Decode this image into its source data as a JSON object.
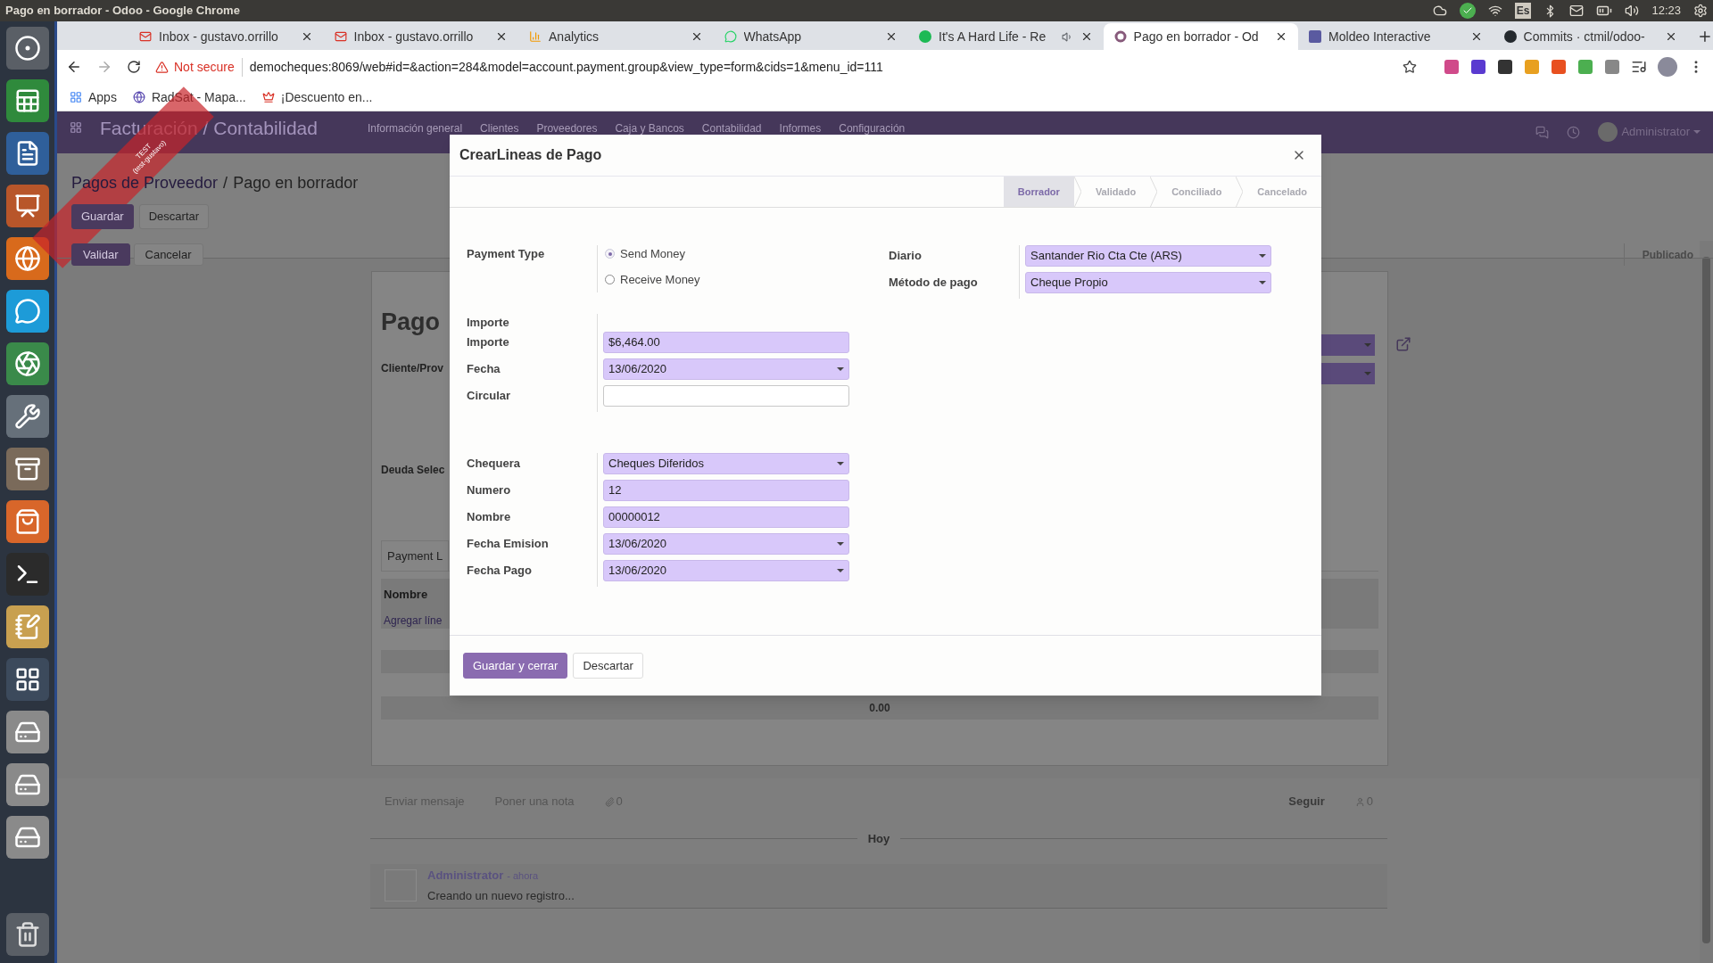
{
  "desktop_bar": {
    "title": "Pago en borrador - Odoo - Google Chrome",
    "keyboard": "Es",
    "clock": "12:23"
  },
  "browser": {
    "tabs": [
      {
        "label": "Inbox - gustavo.orrillo",
        "kind": "mail",
        "selected": false
      },
      {
        "label": "Inbox - gustavo.orrillo",
        "kind": "mail",
        "selected": false
      },
      {
        "label": "Analytics",
        "kind": "chart",
        "selected": false
      },
      {
        "label": "WhatsApp",
        "kind": "chat",
        "selected": false
      },
      {
        "label": "It's A Hard Life - Re",
        "kind": "music",
        "selected": false
      },
      {
        "label": "Pago en borrador - Od",
        "kind": "ring",
        "selected": true
      },
      {
        "label": "Moldeo Interactive",
        "kind": "square",
        "selected": false
      },
      {
        "label": "Commits · ctmil/odoo-",
        "kind": "octo",
        "selected": false
      }
    ],
    "warning": "Not secure",
    "url": "democheques:8069/web#id=&action=284&model=account.payment.group&view_type=form&cids=1&menu_id=111",
    "bookmarks": [
      {
        "label": "Apps",
        "kind": "grid"
      },
      {
        "label": "RadSat - Mapa...",
        "kind": "globe"
      },
      {
        "label": "¡Descuento en...",
        "kind": "crown"
      }
    ]
  },
  "app": {
    "title": "Facturación / Contabilidad",
    "menu": [
      "Información general",
      "Clientes",
      "Proveedores",
      "Caja y Bancos",
      "Contabilidad",
      "Informes",
      "Configuración"
    ],
    "user": "Administrator",
    "ribbon": [
      "TEST",
      "(test-gustavo)"
    ]
  },
  "breadcrumb": {
    "parent": "Pagos de Proveedor",
    "separator": "/",
    "current": "Pago en borrador"
  },
  "edit_buttons": [
    {
      "label": "Guardar",
      "primary": true
    },
    {
      "label": "Descartar",
      "primary": false
    }
  ],
  "status_buttons": [
    {
      "label": "Validar",
      "primary": true
    },
    {
      "label": "Cancelar",
      "primary": false
    }
  ],
  "published": "Publicado",
  "sheet": {
    "title": "Pago",
    "fields": [
      "Cliente/Prov",
      "Deuda Selec"
    ],
    "tab": "Payment L",
    "column": "Nombre",
    "add_line": "Agregar líne",
    "total": "0.00"
  },
  "chatter": {
    "send": "Enviar mensaje",
    "note": "Poner una nota",
    "attachments": "0",
    "follow": "Seguir",
    "followers": "0",
    "date": "Hoy",
    "message": {
      "author": "Administrator",
      "time": "- ahora",
      "body": "Creando un nuevo registro..."
    }
  },
  "dialog": {
    "title": "CrearLineas de Pago",
    "stages": [
      {
        "label": "Borrador",
        "selected": true
      },
      {
        "label": "Validado",
        "selected": false
      },
      {
        "label": "Conciliado",
        "selected": false
      },
      {
        "label": "Cancelado",
        "selected": false
      }
    ],
    "payment_type": {
      "label": "Payment Type",
      "options": [
        {
          "label": "Send Money",
          "selected": true
        },
        {
          "label": "Receive Money",
          "selected": false
        }
      ]
    },
    "right_fields": [
      {
        "label": "Diario",
        "value": "Santander Rio Cta Cte (ARS)",
        "kind": "select",
        "required": true
      },
      {
        "label": "Método de pago",
        "value": "Cheque Propio",
        "kind": "select",
        "required": true
      }
    ],
    "amount_group": {
      "heading": "Importe",
      "fields": [
        {
          "label": "Importe",
          "value": "$6,464.00",
          "kind": "text",
          "required": true
        },
        {
          "label": "Fecha",
          "value": "13/06/2020",
          "kind": "select",
          "required": true
        },
        {
          "label": "Circular",
          "kind": "text",
          "required": false
        }
      ]
    },
    "check_fields": [
      {
        "label": "Chequera",
        "value": "Cheques Diferidos",
        "kind": "select",
        "required": true
      },
      {
        "label": "Numero",
        "value": "12",
        "kind": "text",
        "required": true
      },
      {
        "label": "Nombre",
        "value": "00000012",
        "kind": "text",
        "required": true
      },
      {
        "label": "Fecha Emision",
        "value": "13/06/2020",
        "kind": "select",
        "required": true
      },
      {
        "label": "Fecha Pago",
        "value": "13/06/2020",
        "kind": "select",
        "required": true
      }
    ],
    "buttons": [
      {
        "label": "Guardar y cerrar",
        "primary": true
      },
      {
        "label": "Descartar",
        "primary": false
      }
    ]
  }
}
